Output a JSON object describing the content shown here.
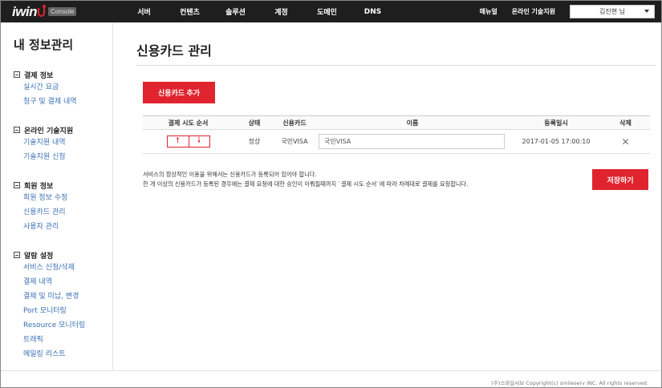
{
  "header": {
    "logo_text": "iwin",
    "console_label": "Console",
    "nav": [
      "서버",
      "컨텐츠",
      "솔루션",
      "계정",
      "도메인",
      "DNS"
    ],
    "manual_label": "매뉴얼",
    "support_label": "온라인 기술지원",
    "user_name": "김진현 님"
  },
  "sidebar": {
    "title": "내 정보관리",
    "groups": [
      {
        "label": "결제 정보",
        "items": [
          "실시간 요금",
          "청구 및 결제 내역"
        ]
      },
      {
        "label": "온라인 기술지원",
        "items": [
          "기술지원 내역",
          "기술지원 신청"
        ]
      },
      {
        "label": "회원 정보",
        "items": [
          "회원 정보 수정",
          "신용카드 관리",
          "사용자 관리"
        ]
      },
      {
        "label": "알람 설정",
        "items": [
          "서비스 신청/삭제",
          "결제 내역",
          "결제 및 미납, 변경",
          "Port 모니터링",
          "Resource 모니터링",
          "트래픽",
          "메일링 리스트"
        ]
      }
    ]
  },
  "main": {
    "title": "신용카드 관리",
    "add_button": "신용카드 추가",
    "columns": [
      "결제 시도 순서",
      "상태",
      "신용카드",
      "이름",
      "등록일시",
      "삭제"
    ],
    "rows": [
      {
        "status": "정상",
        "card": "국민VISA",
        "name": "국민VISA",
        "registered": "2017-01-05 17:00:10"
      }
    ],
    "up_icon": "arrow-up-icon",
    "down_icon": "arrow-down-icon",
    "notice_lines": [
      "서비스의 정상적인 이용을 위해서는 신용카드가 등록되어 있어야 합니다.",
      "한 개 이상의 신용카드가 등록된 경우에는 결제 요청에 대한 승인이 이뤄질때까지 `결제 시도 순서`에 따라 차례대로 결제를 요청합니다."
    ],
    "save_button": "저장하기"
  },
  "footer": {
    "copyright": "(주)스마일서브 Copyright(c) smileserv INC. All rights reserved."
  },
  "colors": {
    "accent": "#e0242e",
    "topbar": "#1e1e1e",
    "link": "#3a6fb5"
  }
}
